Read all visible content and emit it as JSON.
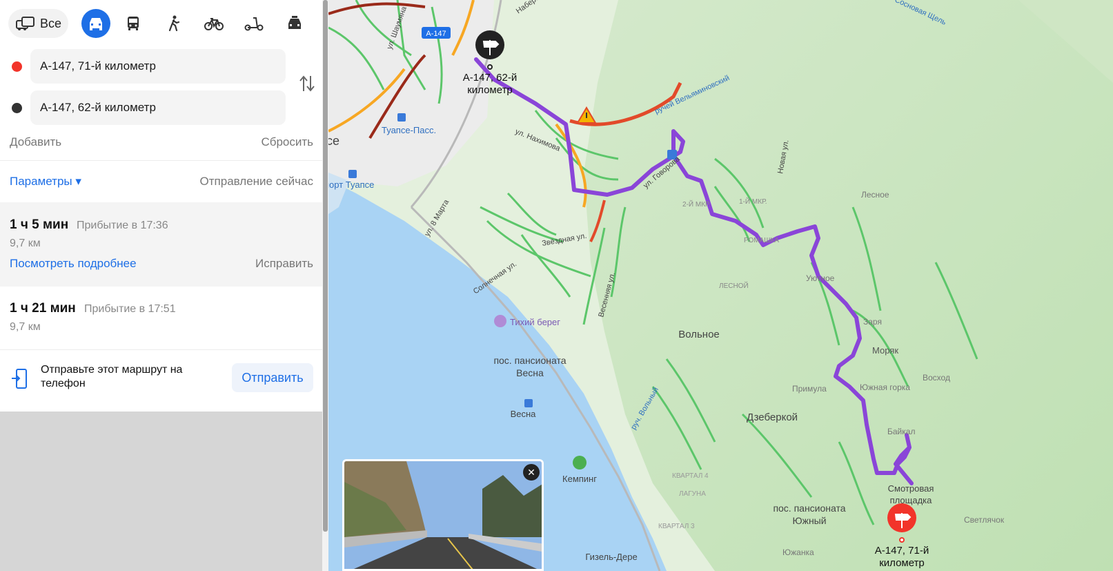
{
  "transport_modes": {
    "all_label": "Все",
    "items": [
      {
        "name": "car",
        "icon": "car-icon",
        "active": true
      },
      {
        "name": "bus",
        "icon": "bus-icon",
        "active": false
      },
      {
        "name": "walk",
        "icon": "walk-icon",
        "active": false
      },
      {
        "name": "bike",
        "icon": "bike-icon",
        "active": false
      },
      {
        "name": "scooter",
        "icon": "scooter-icon",
        "active": false
      },
      {
        "name": "taxi",
        "icon": "taxi-icon",
        "active": false
      }
    ]
  },
  "route_points": {
    "from": {
      "value": "А-147, 71-й километр",
      "dot_color": "#f2342a"
    },
    "to": {
      "value": "А-147, 62-й километр",
      "dot_color": "#333333"
    }
  },
  "actions": {
    "add": "Добавить",
    "reset": "Сбросить"
  },
  "params": {
    "label": "Параметры ▾",
    "departure": "Отправление сейчас"
  },
  "routes": [
    {
      "time": "1 ч 5 мин",
      "arrival": "Прибытие в 17:36",
      "distance": "9,7 км",
      "details": "Посмотреть подробнее",
      "fix": "Исправить",
      "selected": true
    },
    {
      "time": "1 ч 21 мин",
      "arrival": "Прибытие в 17:51",
      "distance": "9,7 км",
      "selected": false
    }
  ],
  "send_to_phone": {
    "text": "Отправьте этот маршрут на телефон",
    "button": "Отправить"
  },
  "map": {
    "road_badge": "A-147",
    "end_marker": "А-147, 62-й километр",
    "start_marker": "А-147, 71-й километр",
    "labels": [
      "ул. Шаумяна",
      "Набере",
      "Туапсе-Пасс.",
      "се",
      "порт Туапсе",
      "ул. Нахимова",
      "ручей Вельяминовский",
      "ул. Говорова",
      "ул. 8 Марта",
      "Звёздная ул.",
      "Солнечная ул.",
      "Весенняя ул.",
      "Тихий берег",
      "пос. пансионата",
      "Весна",
      "Весна",
      "Кемпинг",
      "Гизель-Дере",
      "Вольное",
      "Дзеберкой",
      "2-Й МКР.",
      "1-Й МКР.",
      "РОМАШКА",
      "ЛЕСНОЙ",
      "Новая ул.",
      "Лесное",
      "Уютное",
      "Заря",
      "Моряк",
      "Восход",
      "Примула",
      "Южная горка",
      "Байкал",
      "Смотровая",
      "площадка",
      "пос. пансионата",
      "Южный",
      "Светлячок",
      "Южанка",
      "КВАРТАЛ 4",
      "ЛАГУНА",
      "КВАРТАЛ 3",
      "руч. Вольный",
      "Сосновая Щель"
    ]
  },
  "colors": {
    "accent": "#1e6fe6",
    "route": "#8a45d8",
    "water": "#a9d3f4",
    "land": "#d7ecd0"
  }
}
